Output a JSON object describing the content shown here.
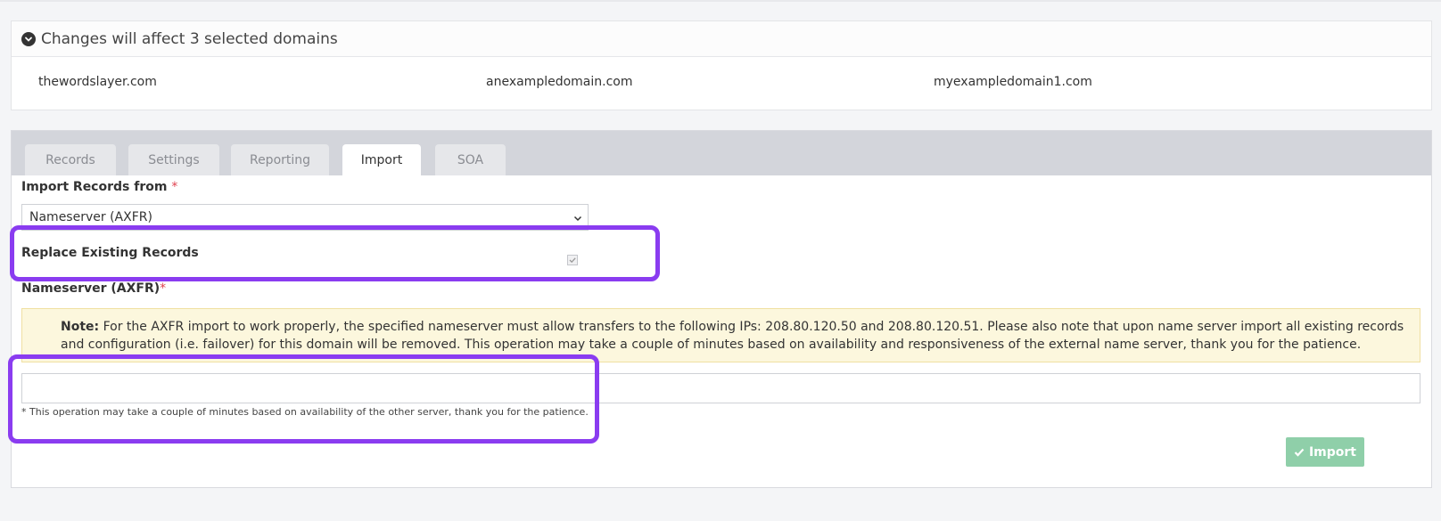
{
  "domains": {
    "header": "Changes will affect 3 selected domains",
    "list": [
      "thewordslayer.com",
      "anexampledomain.com",
      "myexampledomain1.com"
    ]
  },
  "tabs": [
    {
      "label": "Records",
      "active": false
    },
    {
      "label": "Settings",
      "active": false
    },
    {
      "label": "Reporting",
      "active": false
    },
    {
      "label": "Import",
      "active": true
    },
    {
      "label": "SOA",
      "active": false
    }
  ],
  "form": {
    "import_from_label": "Import Records from",
    "required_mark": "*",
    "import_from_value": "Nameserver (AXFR)",
    "replace_label": "Replace Existing Records",
    "replace_checked": true,
    "nameserver_label": "Nameserver (AXFR)",
    "note_title": "Note:",
    "note_text": "For the AXFR import to work properly, the specified nameserver must allow transfers to the following IPs: 208.80.120.50 and 208.80.120.51. Please also note that upon name server import all existing records and configuration (i.e. failover) for this domain will be removed. This operation may take a couple of minutes based on availability and responsiveness of the external name server, thank you for the patience.",
    "nameserver_value": "",
    "helper_text": "* This operation may take a couple of minutes based on availability of the other server, thank you for the patience.",
    "import_button": "Import"
  },
  "colors": {
    "highlight": "#8a3cf0",
    "import_button": "#8fcfa9",
    "note_background": "#fcf7dd",
    "required": "#e0424f"
  }
}
